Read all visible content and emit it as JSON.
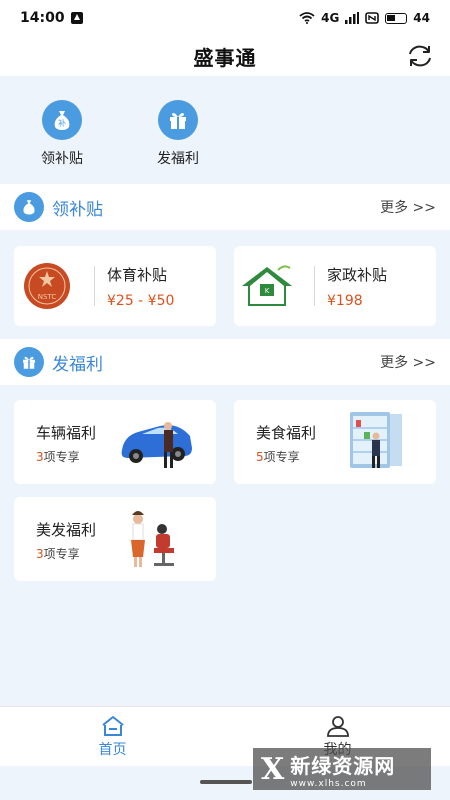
{
  "status": {
    "time": "14:00",
    "network": "4G",
    "battery": "44"
  },
  "header": {
    "title": "盛事通"
  },
  "quick_actions": [
    {
      "label": "领补贴",
      "icon": "money-bag-icon"
    },
    {
      "label": "发福利",
      "icon": "gift-icon"
    }
  ],
  "subsidy_section": {
    "title": "领补贴",
    "more": "更多 >>",
    "items": [
      {
        "name": "体育补贴",
        "price": "¥25 - ¥50",
        "logo_text": "NSTC"
      },
      {
        "name": "家政补贴",
        "price": "¥198"
      }
    ]
  },
  "welfare_section": {
    "title": "发福利",
    "more": "更多 >>",
    "items": [
      {
        "name": "车辆福利",
        "count": "3",
        "suffix": "项专享"
      },
      {
        "name": "美食福利",
        "count": "5",
        "suffix": "项专享"
      },
      {
        "name": "美发福利",
        "count": "3",
        "suffix": "项专享"
      }
    ]
  },
  "bottom_nav": [
    {
      "label": "首页",
      "active": true
    },
    {
      "label": "我的",
      "active": false
    }
  ],
  "watermark": {
    "logo": "X",
    "main": "新绿资源网",
    "url": "www.xlhs.com"
  },
  "colors": {
    "accent": "#3a87d6",
    "icon_bg": "#4a9be0",
    "price": "#d9531e",
    "page_bg": "#eef4fb"
  }
}
